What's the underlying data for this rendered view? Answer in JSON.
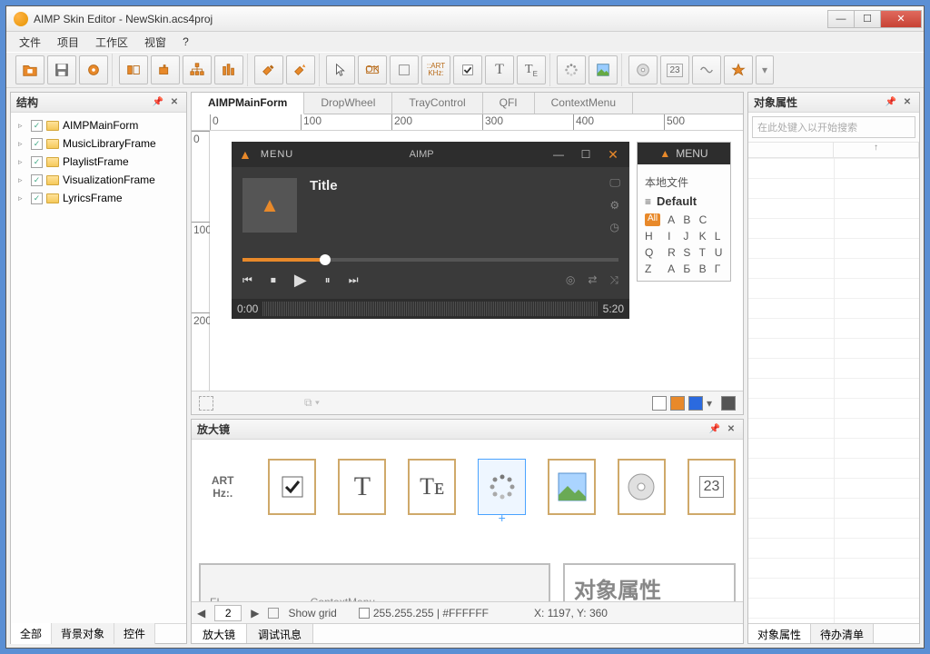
{
  "titlebar": {
    "title": "AIMP Skin Editor - NewSkin.acs4proj"
  },
  "menubar": [
    "文件",
    "项目",
    "工作区",
    "视窗",
    "?"
  ],
  "left_panel": {
    "title": "结构",
    "items": [
      "AIMPMainForm",
      "MusicLibraryFrame",
      "PlaylistFrame",
      "VisualizationFrame",
      "LyricsFrame"
    ],
    "tabs": [
      "全部",
      "背景对象",
      "控件"
    ]
  },
  "design": {
    "tabs": [
      "AIMPMainForm",
      "DropWheel",
      "TrayControl",
      "QFI",
      "ContextMenu"
    ],
    "ruler_h": [
      0,
      100,
      200,
      300,
      400,
      500
    ],
    "ruler_v": [
      0,
      100,
      200
    ],
    "player": {
      "menu": "MENU",
      "app": "AIMP",
      "title": "Title",
      "time_start": "0:00",
      "time_end": "5:20"
    },
    "mini": {
      "menu": "MENU",
      "local": "本地文件",
      "default": "Default",
      "alpha": [
        "All",
        "A",
        "B",
        "C",
        "H",
        "I",
        "J",
        "K",
        "L",
        "Q",
        "R",
        "S",
        "T",
        "U",
        "Z",
        "А",
        "Б",
        "В",
        "Г"
      ]
    }
  },
  "magnifier": {
    "title": "放大镜",
    "art": "ART",
    "hz": "Hz:.",
    "t_big": "T",
    "te": "Tᴇ",
    "num": "23",
    "context": "ContextMenu",
    "ei": "FI",
    "props_label": "对象属性"
  },
  "mag_status": {
    "nav_prev": "◀",
    "nav_next": "▶",
    "value": "2",
    "show_grid": "Show grid",
    "color": "255.255.255 | #FFFFFF",
    "coords": "X: 1197, Y: 360"
  },
  "bottom_tabs": [
    "放大镜",
    "调试讯息"
  ],
  "right_panel": {
    "title": "对象属性",
    "search_placeholder": "在此处键入以开始搜索",
    "sort_icon": "↑",
    "tabs": [
      "对象属性",
      "待办清单"
    ]
  }
}
